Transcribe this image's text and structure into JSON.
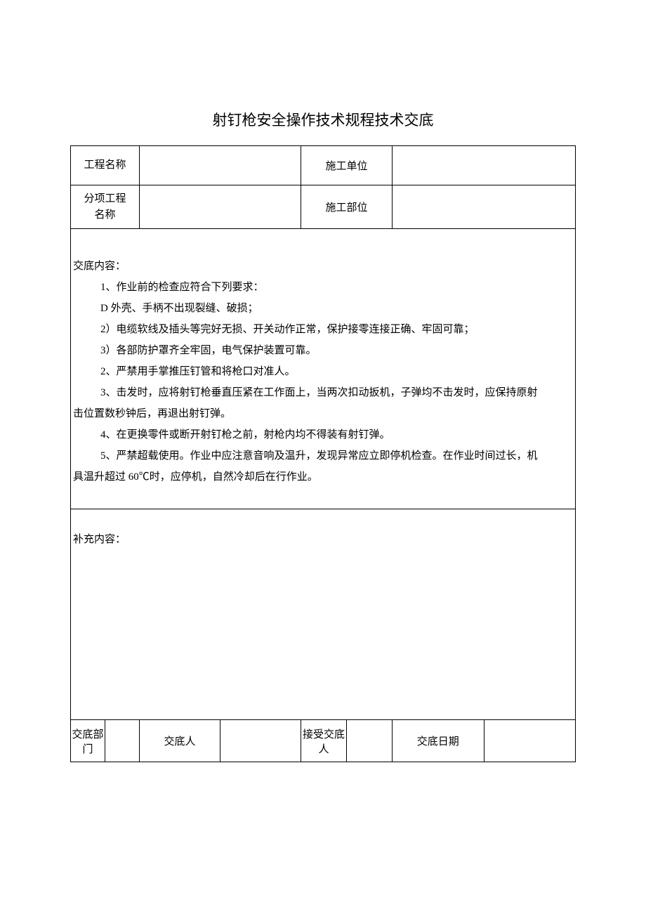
{
  "title": "射钉枪安全操作技术规程技术交底",
  "header": {
    "project_name_label": "工程名称",
    "project_name_value": "",
    "construction_unit_label": "施工单位",
    "construction_unit_value": "",
    "sub_project_label_line1": "分项工程",
    "sub_project_label_line2": "名称",
    "sub_project_value": "",
    "construction_part_label": "施工部位",
    "construction_part_value": ""
  },
  "content": {
    "heading": "交底内容：",
    "item1": "1、作业前的检查应符合下列要求：",
    "item1_sub1": "D 外壳、手柄不出现裂缝、破损；",
    "item1_sub2": "2）电缆软线及插头等完好无损、开关动作正常，保护接零连接正确、牢固可靠；",
    "item1_sub3": "3）各部防护罩齐全牢固，电气保护装置可靠。",
    "item2": "2、严禁用手掌推压钉管和将枪口对准人。",
    "item3_line1": "3、击发时，应将射钉枪垂直压紧在工作面上，当两次扣动扳机，子弹均不击发时，应保持原射",
    "item3_line2": "击位置数秒钟后，再退出射钉弹。",
    "item4": "4、在更换零件或断开射钉枪之前，射枪内均不得装有射钉弹。",
    "item5_line1": "5、严禁超载使用。作业中应注意音响及温升，发现异常应立即停机检查。在作业时间过长，机",
    "item5_line2": "具温升超过 60℃时，应停机，自然冷却后在行作业。"
  },
  "supplement": {
    "heading": "补充内容："
  },
  "footer": {
    "disclosure_dept_label": "交底部门",
    "disclosure_dept_value": "",
    "disclosure_person_label": "交底人",
    "disclosure_person_value": "",
    "receiver_label": "接受交底人",
    "receiver_value": "",
    "disclosure_date_label": "交底日期",
    "disclosure_date_value": ""
  }
}
